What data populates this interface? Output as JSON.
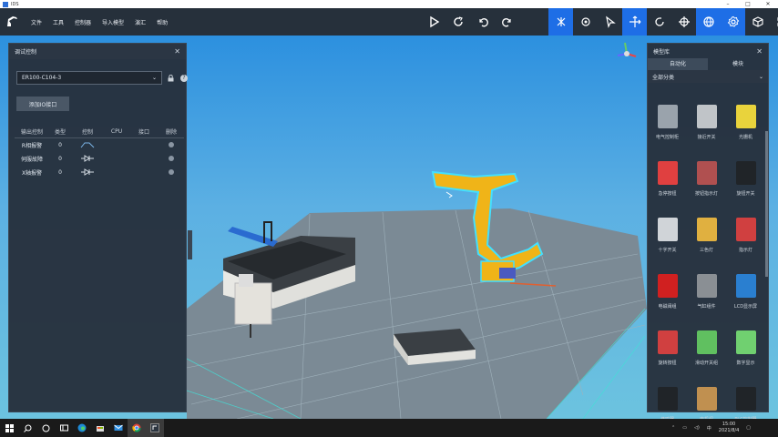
{
  "window": {
    "title": "IDS"
  },
  "menu": [
    "文件",
    "工具",
    "控制器",
    "导入模型",
    "演汇",
    "帮助"
  ],
  "toolbar_icons": [
    "play-icon",
    "redo-icon",
    "undo-icon",
    "undo-arc-icon",
    "select-move-icon",
    "handle-icon",
    "cursor-icon",
    "move-axes-icon",
    "rotate-icon",
    "crosshair-icon",
    "globe-icon",
    "gear-icon",
    "cube-icon",
    "grid-icon"
  ],
  "left_panel": {
    "title": "调试控制",
    "device": "ER100-C104-3",
    "add_button": "添加IO接口",
    "columns": [
      "输出控制",
      "类型",
      "控制",
      "CPU",
      "接口",
      "删除"
    ],
    "rows": [
      {
        "name": "R相报警",
        "type": "0"
      },
      {
        "name": "伺服故障",
        "type": "0"
      },
      {
        "name": "X轴报警",
        "type": "0"
      }
    ]
  },
  "right_panel": {
    "title": "模型库",
    "tabs": [
      "自动化",
      "模块"
    ],
    "category": "全部分类",
    "items": [
      {
        "label": "电气控制柜",
        "icon": "cabinet-icon",
        "color": "#9aa3ac"
      },
      {
        "label": "接近开关",
        "icon": "proximity-sensor-icon",
        "color": "#c0c4c8"
      },
      {
        "label": "光栅机",
        "icon": "light-curtain-icon",
        "color": "#e9d33c"
      },
      {
        "label": "急停按钮",
        "icon": "emergency-stop-icon",
        "color": "#e04040"
      },
      {
        "label": "按钮指示灯",
        "icon": "button-light-icon",
        "color": "#b05050"
      },
      {
        "label": "旋钮开关",
        "icon": "knob-icon",
        "color": "#202428"
      },
      {
        "label": "十字开关",
        "icon": "cross-switch-icon",
        "color": "#d0d4d8"
      },
      {
        "label": "三色灯",
        "icon": "tower-light-icon",
        "color": "#e0b040"
      },
      {
        "label": "指示灯",
        "icon": "indicator-icon",
        "color": "#d04040"
      },
      {
        "label": "电磁阀组",
        "icon": "valve-icon",
        "color": "#d02020"
      },
      {
        "label": "气缸组件",
        "icon": "cylinder-icon",
        "color": "#8a8f94"
      },
      {
        "label": "LCD显示屏",
        "icon": "lcd-icon",
        "color": "#2a7fd0"
      },
      {
        "label": "旋转按钮",
        "icon": "rotary-button-icon",
        "color": "#d04040"
      },
      {
        "label": "滑动开关组",
        "icon": "slide-switch-icon",
        "color": "#60c060"
      },
      {
        "label": "数字显示",
        "icon": "digital-display-icon",
        "color": "#70d070"
      },
      {
        "label": "蜂鸣器",
        "icon": "buzzer-icon",
        "color": "#202428"
      },
      {
        "label": "电机组",
        "icon": "motor-icon",
        "color": "#c09050"
      },
      {
        "label": "PLC控制器",
        "icon": "plc-icon",
        "color": "#202428"
      }
    ]
  },
  "taskbar": {
    "icons": [
      "windows-icon",
      "search-icon",
      "task-view-icon",
      "widgets-icon",
      "edge-icon",
      "store-icon",
      "mail-icon",
      "chrome-icon",
      "ids-app-icon"
    ],
    "time": "15:00",
    "date": "2021/8/4"
  }
}
